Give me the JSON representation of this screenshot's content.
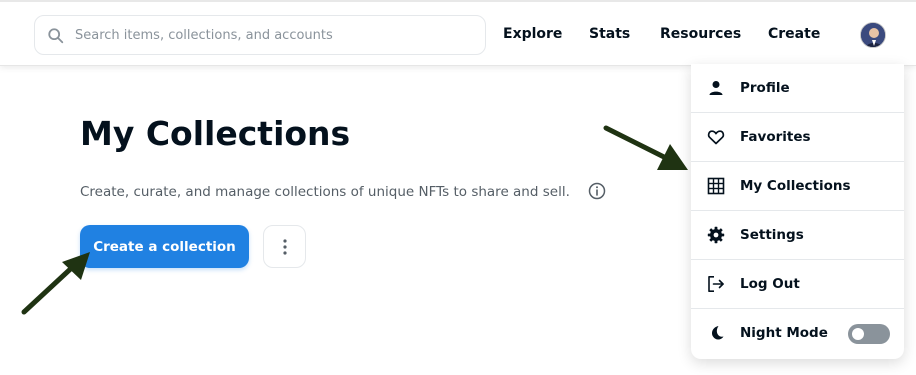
{
  "header": {
    "search_placeholder": "Search items, collections, and accounts",
    "nav": [
      "Explore",
      "Stats",
      "Resources",
      "Create"
    ]
  },
  "main": {
    "title": "My Collections",
    "subtitle": "Create, curate, and manage collections of unique NFTs to share and sell.",
    "create_button": "Create a collection"
  },
  "dropdown": {
    "items": [
      {
        "label": "Profile",
        "icon": "person-icon"
      },
      {
        "label": "Favorites",
        "icon": "heart-icon"
      },
      {
        "label": "My Collections",
        "icon": "grid-icon"
      },
      {
        "label": "Settings",
        "icon": "gear-icon"
      },
      {
        "label": "Log Out",
        "icon": "logout-icon"
      },
      {
        "label": "Night Mode",
        "icon": "moon-icon",
        "toggle_on": false
      }
    ]
  },
  "colors": {
    "primary_button": "#2081e2",
    "annotation_arrow": "#1f3312",
    "toggle_off": "#8a939b"
  }
}
